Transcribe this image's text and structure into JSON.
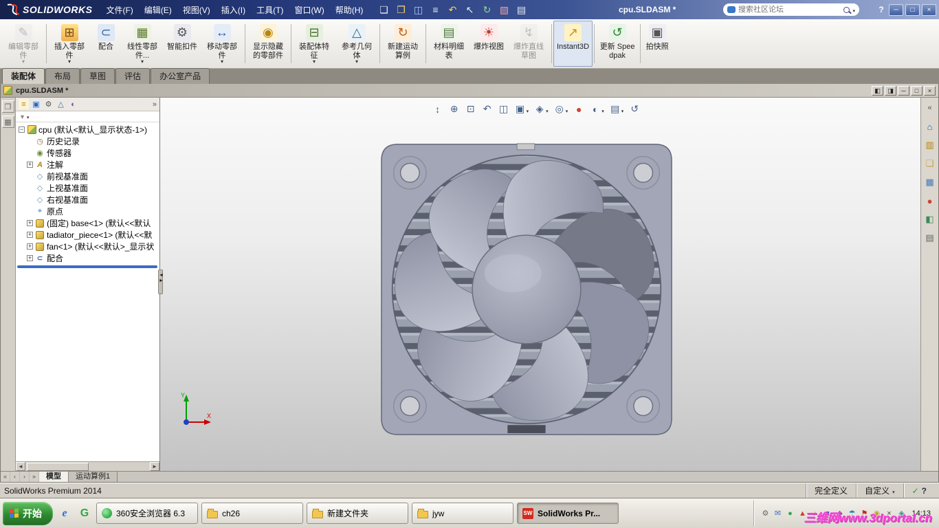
{
  "titlebar": {
    "logo_text": "SOLIDWORKS",
    "menus": [
      "文件(F)",
      "编辑(E)",
      "视图(V)",
      "插入(I)",
      "工具(T)",
      "窗口(W)",
      "帮助(H)"
    ],
    "document_title": "cpu.SLDASM *",
    "search_placeholder": "搜索社区论坛",
    "controls": {
      "help": "?",
      "minimize": "─",
      "maximize": "□",
      "close": "×"
    }
  },
  "quick_icons": [
    {
      "name": "new-document-icon",
      "glyph": "❏"
    },
    {
      "name": "open-icon",
      "glyph": "❐"
    },
    {
      "name": "save-icon",
      "glyph": "◫"
    },
    {
      "name": "print-icon",
      "glyph": "≡"
    },
    {
      "name": "undo-icon",
      "glyph": "↶"
    },
    {
      "name": "select-arrow-icon",
      "glyph": "↖"
    },
    {
      "name": "rebuild-icon",
      "glyph": "↻"
    },
    {
      "name": "color-swatch-icon",
      "glyph": "▧"
    },
    {
      "name": "options-icon",
      "glyph": "▤"
    }
  ],
  "ribbon": {
    "buttons": [
      {
        "label": "编辑零部件",
        "glyph": "✎"
      },
      {
        "label": "插入零部件",
        "glyph": "⊞"
      },
      {
        "label": "配合",
        "glyph": "⊂"
      },
      {
        "label": "线性零部件...",
        "glyph": "▦"
      },
      {
        "label": "智能扣件",
        "glyph": "⚙"
      },
      {
        "label": "移动零部件",
        "glyph": "↔"
      },
      {
        "label": "显示隐藏的零部件",
        "glyph": "◉"
      },
      {
        "label": "装配体特征",
        "glyph": "⊟"
      },
      {
        "label": "参考几何体",
        "glyph": "△"
      },
      {
        "label": "新建运动算例",
        "glyph": "↻"
      },
      {
        "label": "材料明细表",
        "glyph": "▤"
      },
      {
        "label": "爆炸视图",
        "glyph": "☀"
      },
      {
        "label": "爆炸直线草图",
        "glyph": "↯"
      },
      {
        "label": "Instant3D",
        "glyph": "↗"
      },
      {
        "label": "更新 Speedpak",
        "glyph": "↺"
      },
      {
        "label": "拍快照",
        "glyph": "▣"
      }
    ],
    "tabs": [
      {
        "label": "装配体"
      },
      {
        "label": "布局"
      },
      {
        "label": "草图"
      },
      {
        "label": "评估"
      },
      {
        "label": "办公室产品"
      }
    ]
  },
  "docwindow": {
    "title": "cpu.SLDASM *",
    "controls": {
      "tile1": "◧",
      "tile2": "◨",
      "minimize": "─",
      "maximize": "□",
      "close": "×"
    }
  },
  "left_toolbar": [
    {
      "name": "hide-featuremanager-icon",
      "glyph": "❐"
    },
    {
      "name": "assembly-toolbar-icon",
      "glyph": "▦"
    }
  ],
  "featurepanel": {
    "header_icons": [
      {
        "name": "featuremanager-tab-icon",
        "glyph": "≡"
      },
      {
        "name": "propertymanager-tab-icon",
        "glyph": "▣"
      },
      {
        "name": "configurationmanager-tab-icon",
        "glyph": "⚙"
      },
      {
        "name": "dimxpert-tab-icon",
        "glyph": "△"
      },
      {
        "name": "displaymanager-tab-icon",
        "glyph": "◐"
      }
    ],
    "overflow_glyph": "»",
    "filter_glyph": "▼",
    "root_label": "cpu (默认<默认_显示状态-1>)",
    "items": [
      {
        "label": "历史记录",
        "glyph": "◷"
      },
      {
        "label": "传感器",
        "glyph": "◉"
      },
      {
        "label": "注解",
        "glyph": "A"
      },
      {
        "label": "前视基准面",
        "glyph": "◇"
      },
      {
        "label": "上视基准面",
        "glyph": "◇"
      },
      {
        "label": "右视基准面",
        "glyph": "◇"
      },
      {
        "label": "原点",
        "glyph": "⌖"
      },
      {
        "label": "(固定) base<1> (默认<<默认",
        "glyph": ""
      },
      {
        "label": "tadiator_piece<1> (默认<<默",
        "glyph": ""
      },
      {
        "label": "fan<1> (默认<<默认>_显示状",
        "glyph": ""
      },
      {
        "label": "配合",
        "glyph": "⊂"
      }
    ]
  },
  "viewtools": [
    {
      "name": "zoom-fit-icon",
      "glyph": "↕"
    },
    {
      "name": "zoom-in-icon",
      "glyph": "⊕"
    },
    {
      "name": "zoom-area-icon",
      "glyph": "⊡"
    },
    {
      "name": "previous-view-icon",
      "glyph": "↶"
    },
    {
      "name": "section-view-icon",
      "glyph": "◫"
    },
    {
      "name": "view-orientation-icon",
      "glyph": "▣"
    },
    {
      "name": "display-style-icon",
      "glyph": "◈"
    },
    {
      "name": "hide-show-items-icon",
      "glyph": "◎"
    },
    {
      "name": "edit-appearance-icon",
      "glyph": "●"
    },
    {
      "name": "apply-scene-icon",
      "glyph": "◐"
    },
    {
      "name": "view-settings-icon",
      "glyph": "▤"
    },
    {
      "name": "rotate-view-icon",
      "glyph": "↺"
    }
  ],
  "taskpane": [
    {
      "name": "collapse-taskpane-icon",
      "glyph": "«"
    },
    {
      "name": "resources-icon",
      "glyph": "⌂"
    },
    {
      "name": "design-library-icon",
      "glyph": "▥"
    },
    {
      "name": "file-explorer-icon",
      "glyph": "❏"
    },
    {
      "name": "view-palette-icon",
      "glyph": "▦"
    },
    {
      "name": "appearances-icon",
      "glyph": "●"
    },
    {
      "name": "scenes-icon",
      "glyph": "◧"
    },
    {
      "name": "custom-properties-icon",
      "glyph": "▤"
    }
  ],
  "navtabs": {
    "nav": [
      "«",
      "‹",
      "›",
      "»"
    ],
    "tabs": [
      {
        "label": "模型"
      },
      {
        "label": "运动算例1"
      }
    ]
  },
  "statusbar": {
    "app_label": "SolidWorks Premium 2014",
    "define_state": "完全定义",
    "custom_label": "自定义",
    "check_glyph": "✓",
    "help_glyph": "?"
  },
  "taskbar": {
    "start_label": "开始",
    "quick_launch": [
      {
        "name": "internet-explorer-icon",
        "glyph": "e"
      },
      {
        "name": "green-browser-icon",
        "glyph": "G"
      }
    ],
    "items": [
      {
        "label": "360安全浏览器 6.3"
      },
      {
        "label": "ch26"
      },
      {
        "label": "新建文件夹"
      },
      {
        "label": "jyw"
      },
      {
        "label": "SolidWorks Pr...",
        "icon_glyph": "SW"
      }
    ],
    "tray_glyphs": [
      "⚙",
      "✉",
      "●",
      "▲",
      "♪",
      "■",
      "◆",
      "☂",
      "⚑",
      "◉",
      "×",
      "◈"
    ],
    "time": "14:13"
  },
  "triad": {
    "x": "X",
    "y": "Y"
  },
  "watermark": {
    "text": "三维网www.3dportal.cn"
  }
}
